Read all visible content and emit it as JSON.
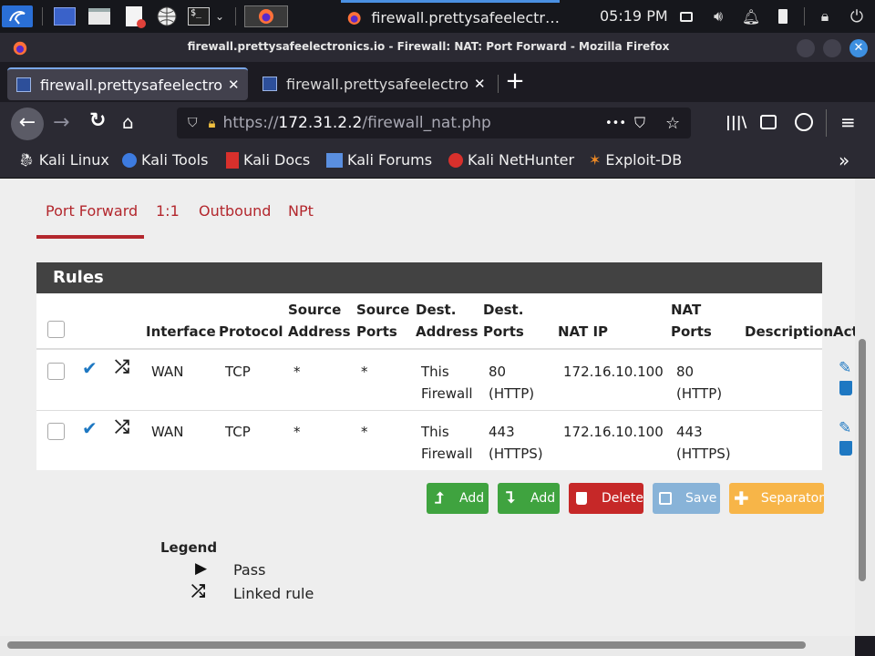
{
  "taskbar": {
    "active_window": "firewall.prettysafeelectr…",
    "clock": "05:19 PM"
  },
  "window": {
    "title": "firewall.prettysafeelectronics.io - Firewall: NAT: Port Forward - Mozilla Firefox"
  },
  "tabs": [
    {
      "label": "firewall.prettysafeelectro"
    },
    {
      "label": "firewall.prettysafeelectro"
    }
  ],
  "address_bar": {
    "scheme": "https://",
    "host": "172.31.2.2",
    "path": "/firewall_nat.php",
    "more": "•••"
  },
  "bookmarks": [
    {
      "label": "Kali Linux",
      "icon": "kali-dragon-icon"
    },
    {
      "label": "Kali Tools",
      "icon": "kali-tools-icon"
    },
    {
      "label": "Kali Docs",
      "icon": "kali-docs-icon"
    },
    {
      "label": "Kali Forums",
      "icon": "kali-forums-icon"
    },
    {
      "label": "Kali NetHunter",
      "icon": "nethunter-icon"
    },
    {
      "label": "Exploit-DB",
      "icon": "exploitdb-icon"
    }
  ],
  "nat_tabs": {
    "port_forward": "Port Forward",
    "one_to_one": "1:1",
    "outbound": "Outbound",
    "npt": "NPt"
  },
  "rules": {
    "title": "Rules",
    "headers": {
      "interface": "Interface",
      "protocol": "Protocol",
      "source_address_1": "Source",
      "source_address_2": "Address",
      "source_ports_1": "Source",
      "source_ports_2": "Ports",
      "dest_address_1": "Dest.",
      "dest_address_2": "Address",
      "dest_ports_1": "Dest.",
      "dest_ports_2": "Ports",
      "nat_ip": "NAT IP",
      "nat_ports_1": "NAT",
      "nat_ports_2": "Ports",
      "description": "Description",
      "actions": "Actions"
    },
    "rows": [
      {
        "interface": "WAN",
        "protocol": "TCP",
        "source_address": "*",
        "source_ports": "*",
        "dest_address_1": "This",
        "dest_address_2": "Firewall",
        "dest_ports_1": "80",
        "dest_ports_2": "(HTTP)",
        "nat_ip": "172.16.10.100",
        "nat_ports_1": "80",
        "nat_ports_2": "(HTTP)",
        "description": ""
      },
      {
        "interface": "WAN",
        "protocol": "TCP",
        "source_address": "*",
        "source_ports": "*",
        "dest_address_1": "This",
        "dest_address_2": "Firewall",
        "dest_ports_1": "443",
        "dest_ports_2": "(HTTPS)",
        "nat_ip": "172.16.10.100",
        "nat_ports_1": "443",
        "nat_ports_2": "(HTTPS)",
        "description": ""
      }
    ]
  },
  "buttons": {
    "add_top": "Add",
    "add_bottom": "Add",
    "delete": "Delete",
    "save": "Save",
    "separator": "Separator"
  },
  "legend": {
    "title": "Legend",
    "pass": "Pass",
    "linked": "Linked rule"
  },
  "colors": {
    "accent_red": "#b3272d",
    "add_green": "#3fa33f",
    "delete_red": "#c62828",
    "save_blue": "#88b3d8",
    "separator_orange": "#f7b548",
    "pass_blue": "#1e78c2",
    "panel_header": "#424242"
  }
}
